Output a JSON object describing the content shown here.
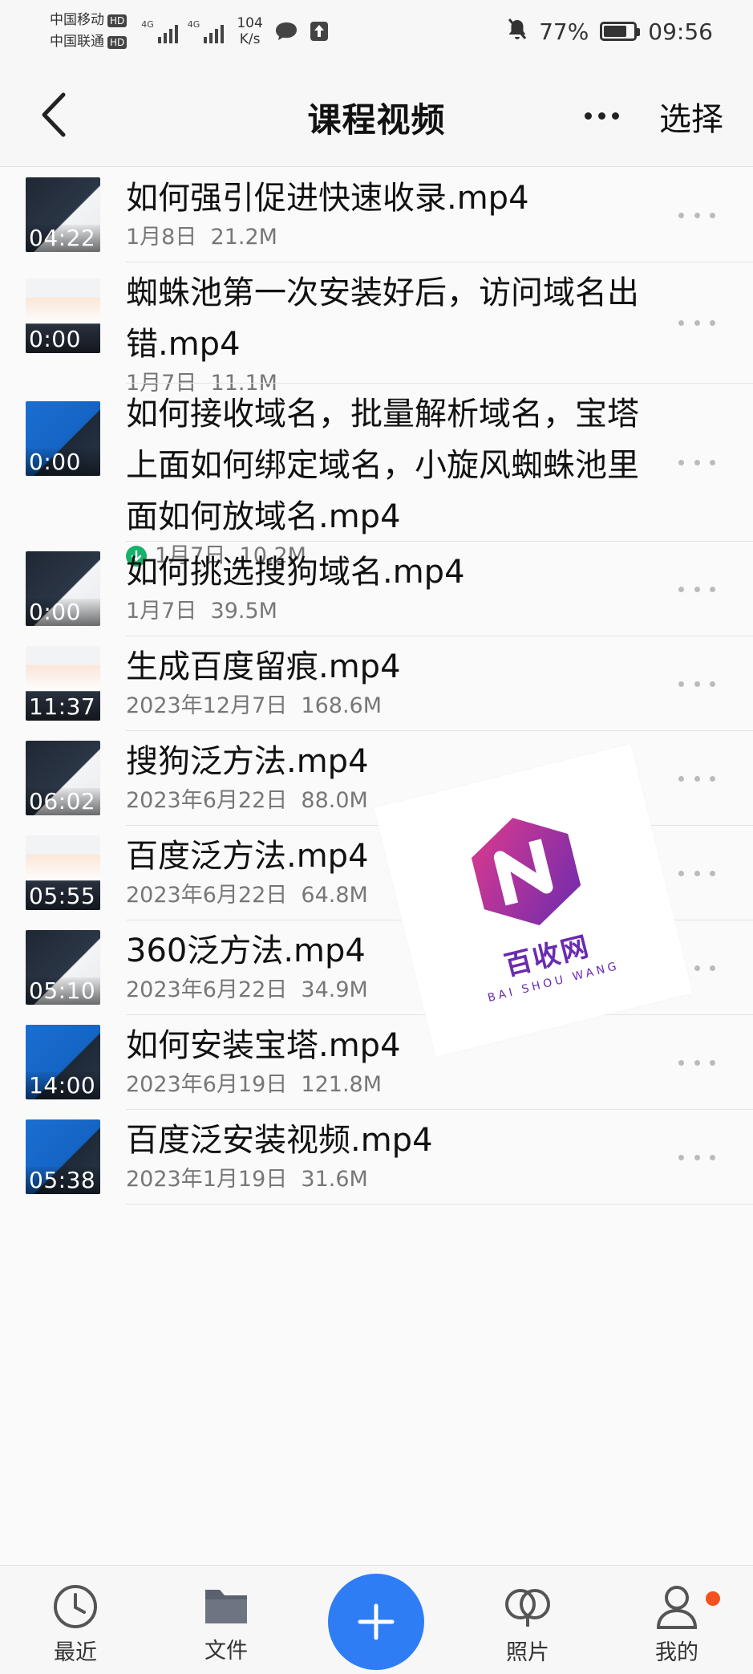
{
  "status_bar": {
    "carrier1": "中国移动",
    "carrier2": "中国联通",
    "hd": "HD",
    "net1": "4G",
    "net2": "4G",
    "speed_value": "104",
    "speed_unit": "K/s",
    "battery": "77%",
    "battery_level": 0.77,
    "time": "09:56"
  },
  "header": {
    "title": "课程视频",
    "select_label": "选择"
  },
  "files": [
    {
      "name": "如何强引促进快速收录.mp4",
      "meta": "1月8日  21.2M",
      "duration": "04:22",
      "downloaded": false,
      "thumb": "dark"
    },
    {
      "name": "蜘蛛池第一次安装好后，访问域名出错.mp4",
      "meta": "1月7日  11.1M",
      "duration": "0:00",
      "downloaded": false,
      "thumb": "light"
    },
    {
      "name": "如何接收域名，批量解析域名，宝塔上面如何绑定域名，小旋风蜘蛛池里面如何放域名.mp4",
      "meta": "1月7日  10.2M",
      "duration": "0:00",
      "downloaded": true,
      "thumb": "blue"
    },
    {
      "name": "如何挑选搜狗域名.mp4",
      "meta": "1月7日  39.5M",
      "duration": "0:00",
      "downloaded": false,
      "thumb": "dark"
    },
    {
      "name": "生成百度留痕.mp4",
      "meta": "2023年12月7日  168.6M",
      "duration": "11:37",
      "downloaded": false,
      "thumb": "light"
    },
    {
      "name": "搜狗泛方法.mp4",
      "meta": "2023年6月22日  88.0M",
      "duration": "06:02",
      "downloaded": false,
      "thumb": "dark"
    },
    {
      "name": "百度泛方法.mp4",
      "meta": "2023年6月22日  64.8M",
      "duration": "05:55",
      "downloaded": false,
      "thumb": "light"
    },
    {
      "name": "360泛方法.mp4",
      "meta": "2023年6月22日  34.9M",
      "duration": "05:10",
      "downloaded": false,
      "thumb": "dark"
    },
    {
      "name": "如何安装宝塔.mp4",
      "meta": "2023年6月19日  121.8M",
      "duration": "14:00",
      "downloaded": false,
      "thumb": "blue"
    },
    {
      "name": "百度泛安装视频.mp4",
      "meta": "2023年1月19日  31.6M",
      "duration": "05:38",
      "downloaded": false,
      "thumb": "blue"
    }
  ],
  "watermark": {
    "name": "百收网",
    "sub": "BAI SHOU WANG"
  },
  "bottom_nav": {
    "recent": "最近",
    "files": "文件",
    "photos": "照片",
    "mine": "我的"
  },
  "colors": {
    "accent": "#2f7df4",
    "download_green": "#18b26b",
    "notify_red": "#f4511e"
  }
}
